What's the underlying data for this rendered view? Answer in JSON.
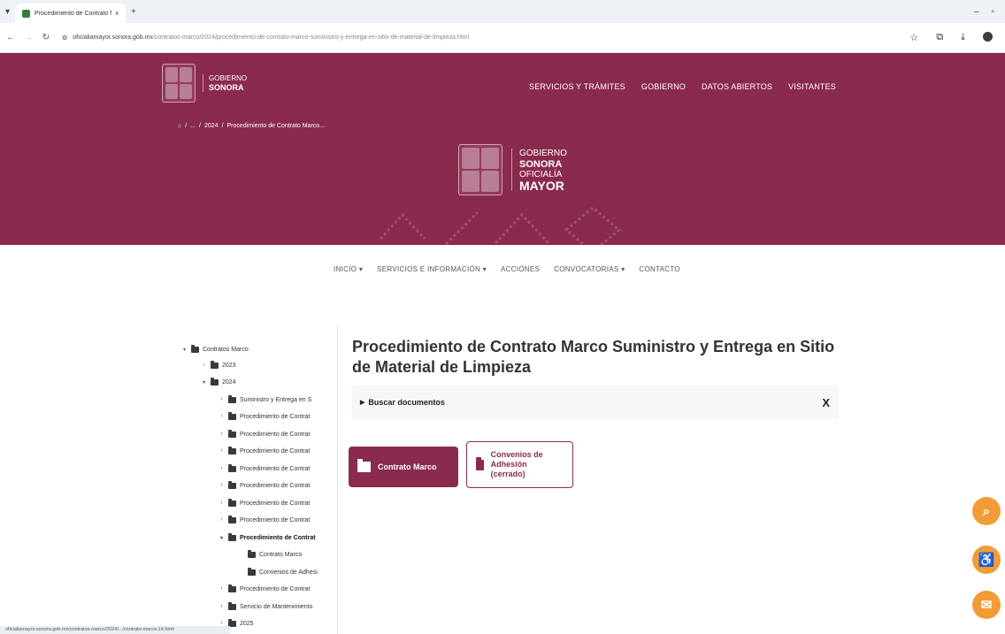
{
  "browser": {
    "tab_title": "Procedimiento de Contrato M",
    "close_glyph": "x",
    "new_tab_glyph": "+",
    "url_host": "oficialiamayor.sonora.gob.mx",
    "url_path": "/contratos-marco/2024/procedimiento-de-contrato-marco-suministro-y-entrega-en-sitio-de-material-de-limpieza.html"
  },
  "header": {
    "logo_line1": "GOBIERNO",
    "logo_line2": "SONORA",
    "nav": [
      "SERVICIOS Y TRÁMITES",
      "GOBIERNO",
      "DATOS ABIERTOS",
      "VISITANTES"
    ],
    "breadcrumb": [
      "/",
      "...",
      "/",
      "2024",
      "/",
      "Procedimiento de Contrato Marco..."
    ],
    "center_logo": {
      "line1": "GOBIERNO",
      "line2": "SONORA",
      "line3": "OFICIALÍA",
      "line4": "MAYOR"
    }
  },
  "menu": [
    "INICIO ▾",
    "SERVICIOS E INFORMACIÓN ▾",
    "ACCIONES",
    "CONVOCATORIAS ▾",
    "CONTACTO"
  ],
  "sidebar": {
    "items": [
      {
        "label": "Contratos Marco",
        "toggle": "▾"
      },
      {
        "label": "2023",
        "toggle": "›"
      },
      {
        "label": "2024",
        "toggle": "▾"
      },
      {
        "label": "Suministro y Entrega en S",
        "toggle": "›"
      },
      {
        "label": "Procedimiento de Contrat",
        "toggle": "›"
      },
      {
        "label": "Procedimiento de Contrat",
        "toggle": "›"
      },
      {
        "label": "Procedimiento de Contrat",
        "toggle": "›"
      },
      {
        "label": "Procedimiento de Contrat",
        "toggle": "›"
      },
      {
        "label": "Procedimiento de Contrat",
        "toggle": "›"
      },
      {
        "label": "Procedimiento de Contrat",
        "toggle": "›"
      },
      {
        "label": "Procedimiento de Contrat",
        "toggle": "›"
      },
      {
        "label": "Procedimiento de Contrat",
        "toggle": "▾"
      },
      {
        "label": "Contrato Marco",
        "toggle": ""
      },
      {
        "label": "Convenios de Adhesi",
        "toggle": ""
      },
      {
        "label": "Procedimiento de Contrat",
        "toggle": "›"
      },
      {
        "label": "Servicio de Mantenimiento",
        "toggle": "›"
      },
      {
        "label": "2025",
        "toggle": "›"
      }
    ]
  },
  "main": {
    "title": "Procedimiento de Contrato Marco Suministro y Entrega en Sitio de Material de Limpieza",
    "search_label": "Buscar documentos",
    "search_close": "X",
    "folders": [
      "Contrato Marco",
      "Convenios de Adhesión (cerrado)"
    ]
  },
  "status_url": "oficialiamayor.sonora.gob.mx/contratos-marco/2024/.../contrato-marco-14.html",
  "colors": {
    "brand": "#8a2a4f",
    "fab": "#f39c35"
  }
}
